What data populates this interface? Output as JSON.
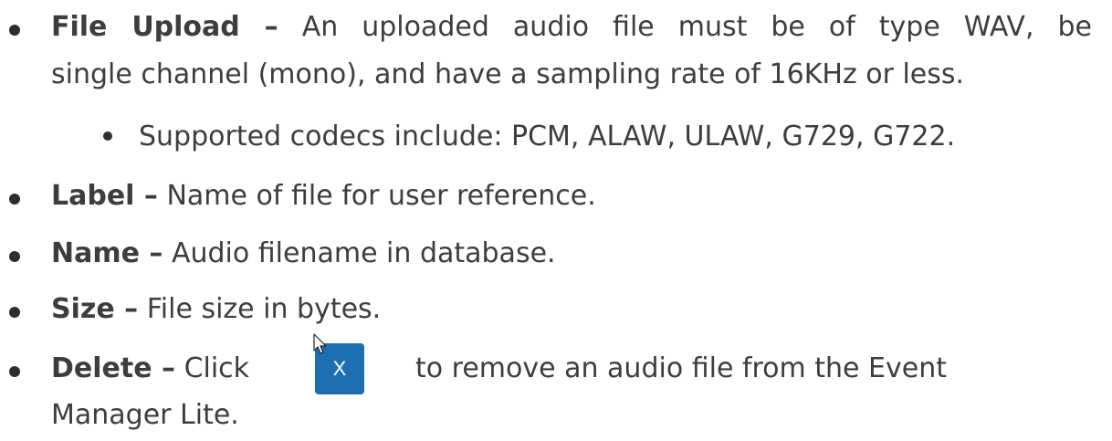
{
  "items": [
    {
      "term": "File Upload –",
      "lines": [
        "An uploaded audio file must be of type WAV, be",
        "single channel (mono), and have a sampling rate of 16KHz or less."
      ],
      "sub_items": [
        "Supported codecs include: PCM, ALAW, ULAW, G729, G722."
      ]
    },
    {
      "term": "Label –",
      "text": "Name of file for user reference."
    },
    {
      "term": "Name –",
      "text": "Audio filename in database."
    },
    {
      "term": "Size –",
      "text": "File size in bytes."
    },
    {
      "term": "Delete –",
      "before_button": "Click",
      "button_label": "X",
      "after_button": "to remove an audio file from the Event",
      "continuation": "Manager Lite."
    }
  ],
  "colors": {
    "text": "#3d3d3d",
    "bullet": "#2e2e2e",
    "button_bg": "#1d6fb2",
    "button_text": "#ffffff"
  },
  "icons": {
    "cursor": "mouse-pointer-icon"
  }
}
